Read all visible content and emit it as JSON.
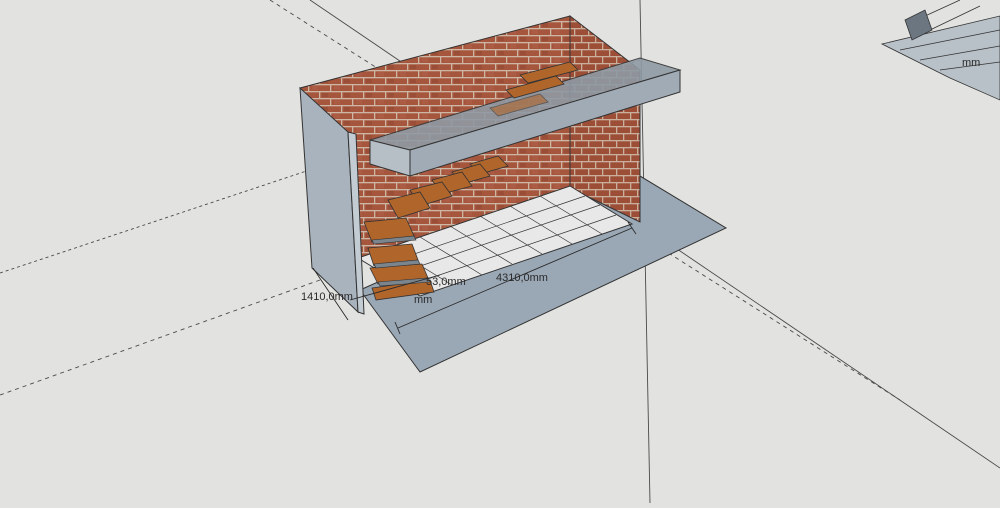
{
  "dimensions": {
    "width_label": "1410,0mm",
    "length_label": "4310,0mm",
    "partial_label": "53,0mm",
    "step_label": "mm",
    "right_model_label": "mm"
  },
  "colors": {
    "background": "#e2e2e0",
    "brick": "#a8583f",
    "mortar": "#cfb9a6",
    "glass": "#a9b3bd",
    "tread": "#b0652b",
    "floor_shadow": "#9aa7b5"
  }
}
